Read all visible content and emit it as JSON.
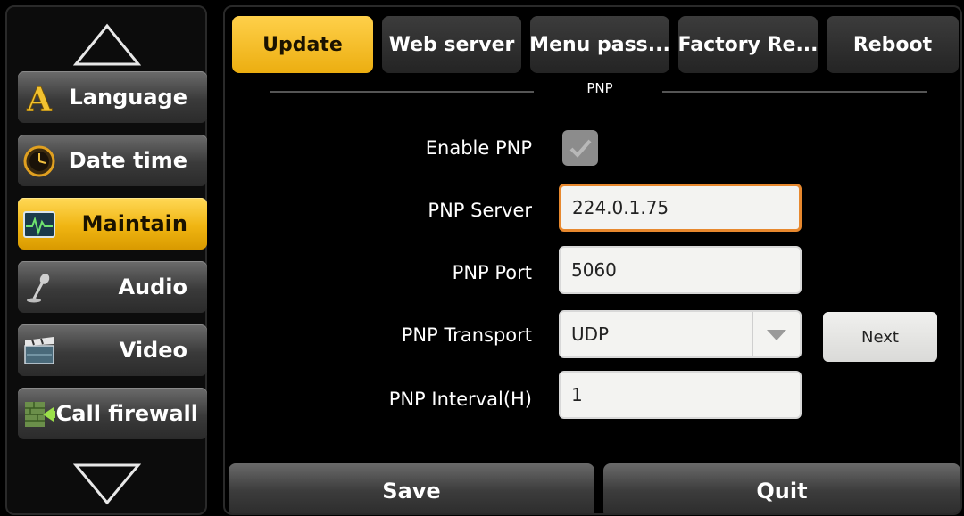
{
  "sidebar": {
    "items": [
      {
        "label": "Language",
        "icon": "letter-a-icon",
        "active": false
      },
      {
        "label": "Date time",
        "icon": "clock-icon",
        "active": false
      },
      {
        "label": "Maintain",
        "icon": "heartbeat-monitor-icon",
        "active": true
      },
      {
        "label": "Audio",
        "icon": "microphone-icon",
        "active": false
      },
      {
        "label": "Video",
        "icon": "film-clapper-icon",
        "active": false
      },
      {
        "label": "Call firewall",
        "icon": "firewall-icon",
        "active": false
      }
    ]
  },
  "tabs": [
    {
      "label": "Update",
      "active": true
    },
    {
      "label": "Web server",
      "active": false
    },
    {
      "label": "Menu pass...",
      "active": false
    },
    {
      "label": "Factory Re...",
      "active": false
    },
    {
      "label": "Reboot",
      "active": false
    }
  ],
  "section": {
    "title": "PNP"
  },
  "form": {
    "enable_pnp": {
      "label": "Enable PNP",
      "checked": true
    },
    "pnp_server": {
      "label": "PNP Server",
      "value": "224.0.1.75"
    },
    "pnp_port": {
      "label": "PNP Port",
      "value": "5060"
    },
    "pnp_transport": {
      "label": "PNP Transport",
      "value": "UDP"
    },
    "pnp_interval": {
      "label": "PNP Interval(H)",
      "value": "1"
    }
  },
  "buttons": {
    "next": "Next",
    "save": "Save",
    "quit": "Quit"
  },
  "colors": {
    "accent": "#f0b512",
    "focus_border": "#e7882e",
    "background": "#000000"
  }
}
